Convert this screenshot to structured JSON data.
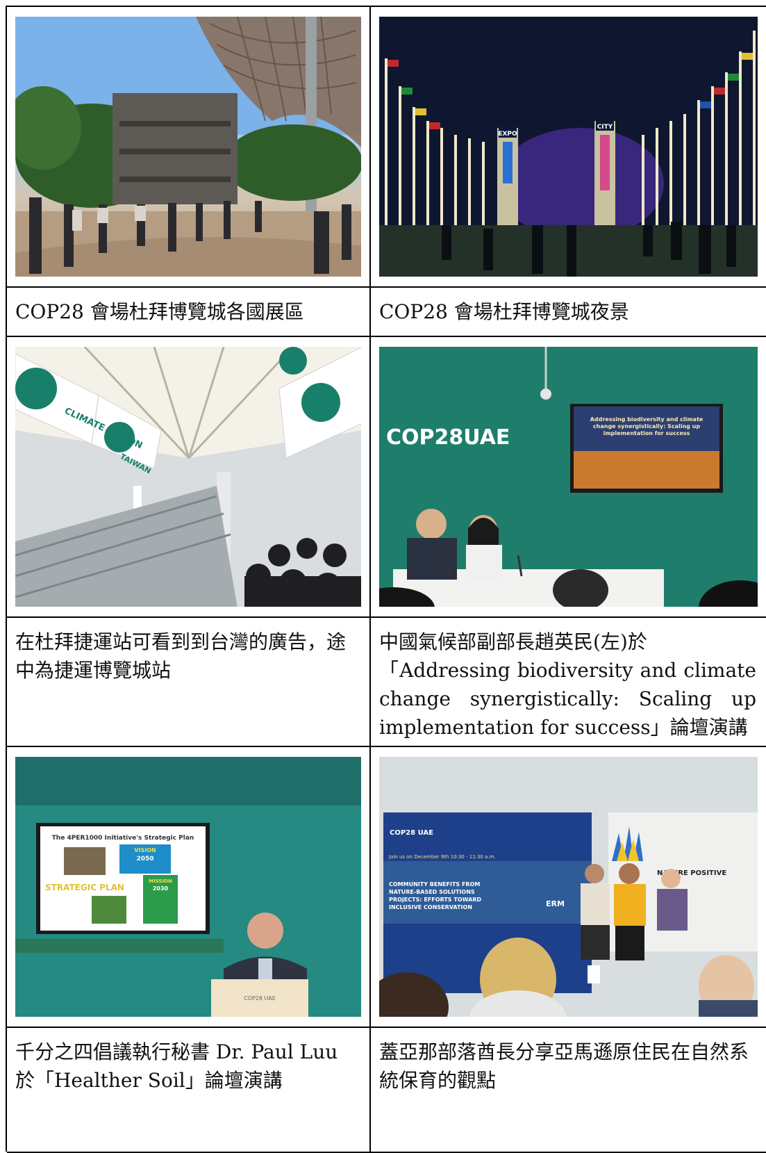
{
  "rows": [
    {
      "left": {
        "photo_icon": "expo-city-pavilions-photo",
        "caption": "COP28 會場杜拜博覽城各國展區"
      },
      "right": {
        "photo_icon": "expo-city-night-photo",
        "caption": "COP28 會場杜拜博覽城夜景"
      }
    },
    {
      "left": {
        "photo_icon": "metro-station-ads-photo",
        "caption": "在杜拜捷運站可看到到台灣的廣告，途中為捷運博覽城站"
      },
      "right": {
        "photo_icon": "forum-speakers-photo",
        "caption_line1": "中國氣候部副部長趙英民(左)於",
        "caption_line2": "「Addressing biodiversity and climate change synergistically: Scaling up implementation for success」論壇演講"
      }
    },
    {
      "left": {
        "photo_icon": "podium-speaker-photo",
        "caption": "千分之四倡議執行秘書 Dr. Paul Luu 於「Healther Soil」論壇演講"
      },
      "right": {
        "photo_icon": "panel-discussion-photo",
        "caption": "蓋亞那部落酋長分享亞馬遜原住民在自然系統保育的觀點"
      }
    }
  ],
  "photo_text": {
    "expo": "EXPO",
    "city": "CITY",
    "climate_action": "CLIMATE ACTION",
    "taiwan": "TAIWAN",
    "cop28uae": "COP28UAE",
    "slide_title": "Addressing biodiversity and climate change synergistically: Scaling up implementation for success",
    "strategic_title": "The 4PER1000 Initiative's Strategic Plan",
    "vision": "VISION",
    "vision_year": "2050",
    "strategic_plan": "STRATEGIC PLAN",
    "mission": "MISSION",
    "mission_year": "2030",
    "cop28_short": "COP28 UAE",
    "panel_date": "Join us on December 9th 10:30 - 11:30 a.m.",
    "panel_title": "COMMUNITY BENEFITS FROM NATURE-BASED SOLUTIONS PROJECTS: EFFORTS TOWARD INCLUSIVE CONSERVATION",
    "erm": "ERM",
    "nature_positive": "NATURE POSITIVE"
  }
}
